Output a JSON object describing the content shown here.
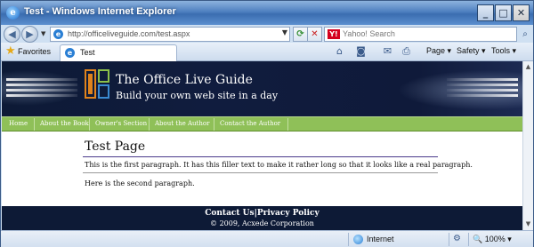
{
  "window": {
    "title": "Test - Windows Internet Explorer",
    "minimize": "_",
    "maximize": "□",
    "close": "✕"
  },
  "nav": {
    "url": "http://officeliveguide.com/test.aspx",
    "search_placeholder": "Yahoo! Search",
    "search_provider_short": "Y!"
  },
  "favorites_bar": {
    "favorites_label": "Favorites",
    "tab_label": "Test"
  },
  "command_bar": {
    "page_label": "Page ▾",
    "safety_label": "Safety ▾",
    "tools_label": "Tools ▾"
  },
  "site": {
    "title": "The Office Live Guide",
    "tagline": "Build your own web site in a day",
    "menu": [
      "Home",
      "About the Book",
      "Owner's Section",
      "About the Author",
      "Contact the Author"
    ],
    "page_heading": "Test Page",
    "paragraph1": "This is the first paragraph. It has this filler text to make it rather long so that it looks like a real paragraph.",
    "paragraph2": "Here is the second paragraph.",
    "footer_links": "Contact Us|Privacy Policy",
    "footer_copyright": "© 2009, Acxede Corporation"
  },
  "statusbar": {
    "zone": "Internet",
    "zoom": "100%"
  },
  "colors": {
    "header_bg": "#0d1a36",
    "menu_bg": "#8fc058",
    "rule": "#4b3a8c",
    "titlebar": "#4f80c0"
  }
}
